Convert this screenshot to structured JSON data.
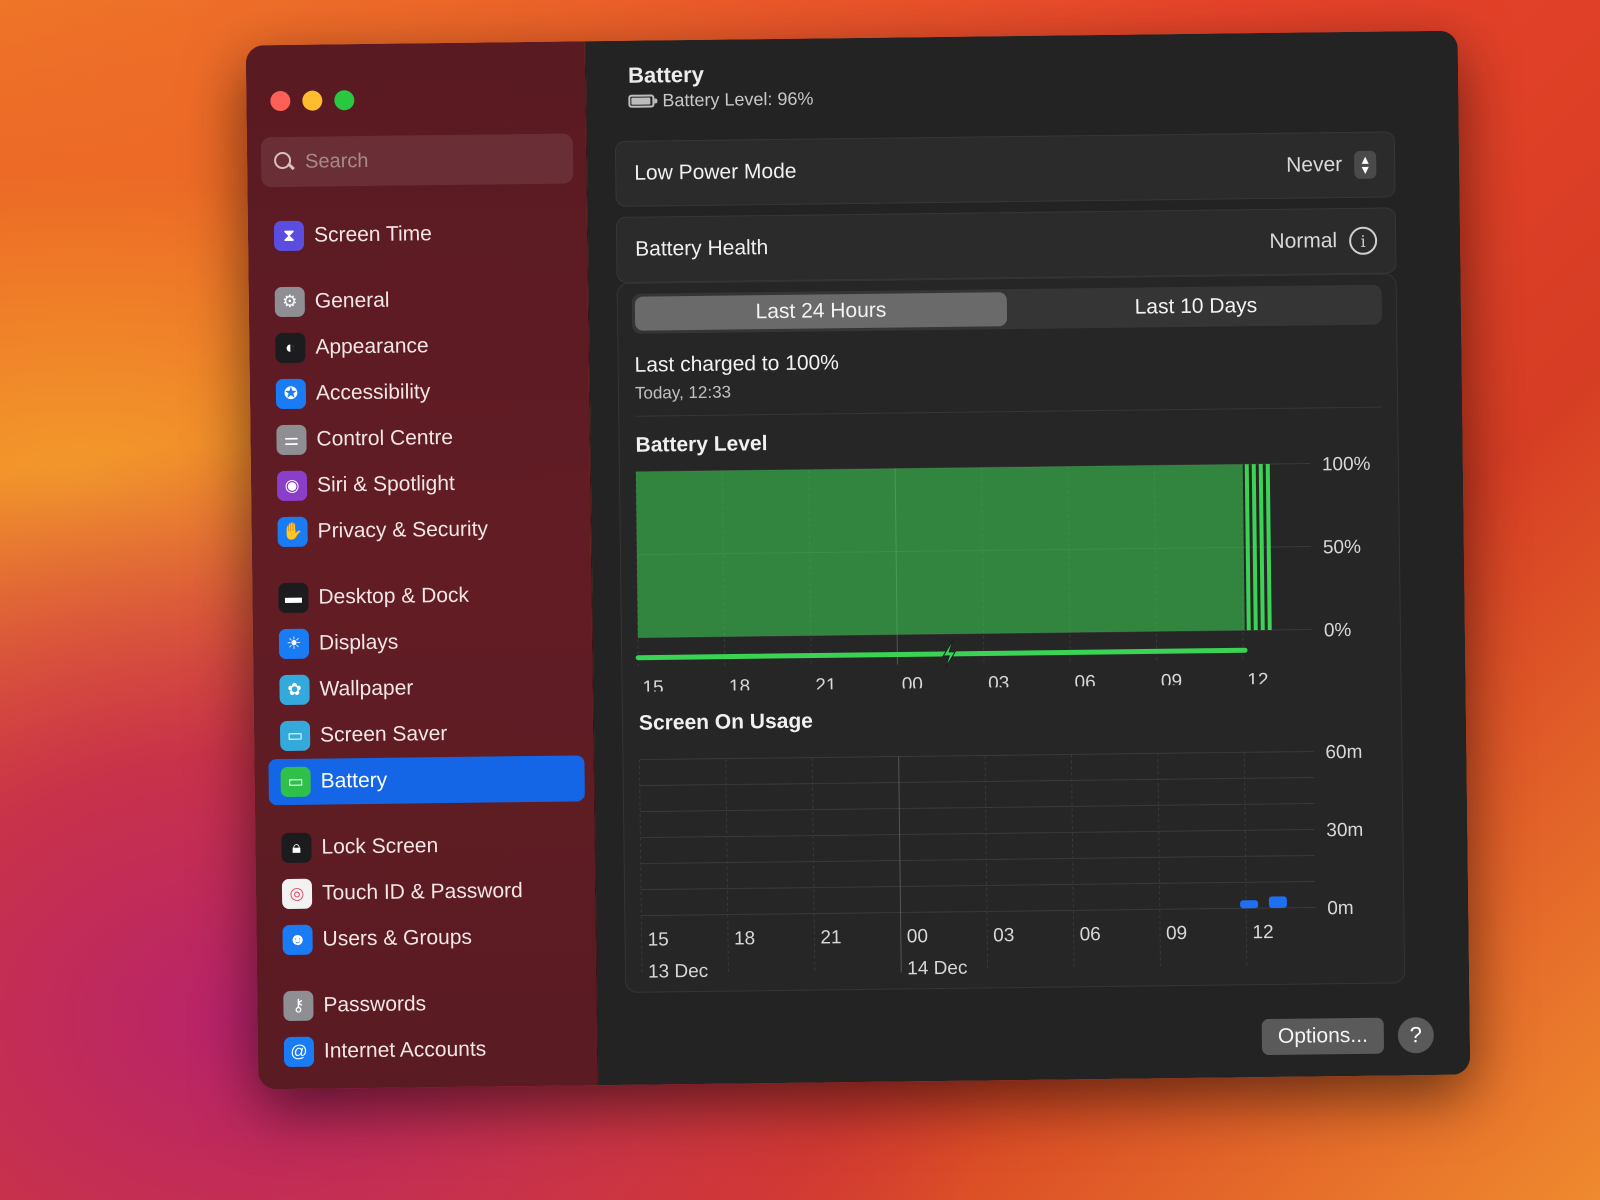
{
  "window": {
    "controls": [
      "close",
      "minimize",
      "zoom"
    ]
  },
  "sidebar": {
    "search_placeholder": "Search",
    "groups": [
      [
        {
          "label": "Screen Time",
          "icon": "hourglass-icon",
          "color": "#5b4de0"
        }
      ],
      [
        {
          "label": "General",
          "icon": "gear-icon",
          "color": "#8e8e93"
        },
        {
          "label": "Appearance",
          "icon": "appearance-icon",
          "color": "#1c1c1e"
        },
        {
          "label": "Accessibility",
          "icon": "accessibility-icon",
          "color": "#1a7cf5"
        },
        {
          "label": "Control Centre",
          "icon": "toggles-icon",
          "color": "#8e8e93"
        },
        {
          "label": "Siri & Spotlight",
          "icon": "siri-icon",
          "color": "#8a3ec9"
        },
        {
          "label": "Privacy & Security",
          "icon": "hand-icon",
          "color": "#1a7cf5"
        }
      ],
      [
        {
          "label": "Desktop & Dock",
          "icon": "dock-icon",
          "color": "#1c1c1e"
        },
        {
          "label": "Displays",
          "icon": "sun-icon",
          "color": "#1a7cf5"
        },
        {
          "label": "Wallpaper",
          "icon": "flower-icon",
          "color": "#34aadc"
        },
        {
          "label": "Screen Saver",
          "icon": "screensaver-icon",
          "color": "#34aadc"
        },
        {
          "label": "Battery",
          "icon": "battery-icon",
          "color": "#2fc04b",
          "selected": true
        }
      ],
      [
        {
          "label": "Lock Screen",
          "icon": "lock-icon",
          "color": "#1c1c1e"
        },
        {
          "label": "Touch ID & Password",
          "icon": "fingerprint-icon",
          "color": "#f2f2f2"
        },
        {
          "label": "Users & Groups",
          "icon": "users-icon",
          "color": "#1a7cf5"
        }
      ],
      [
        {
          "label": "Passwords",
          "icon": "key-icon",
          "color": "#8e8e93"
        },
        {
          "label": "Internet Accounts",
          "icon": "at-icon",
          "color": "#1a7cf5"
        }
      ]
    ]
  },
  "header": {
    "title": "Battery",
    "subtitle": "Battery Level: 96%"
  },
  "low_power": {
    "label": "Low Power Mode",
    "value": "Never"
  },
  "health": {
    "label": "Battery Health",
    "value": "Normal"
  },
  "tabs": [
    {
      "label": "Last 24 Hours",
      "active": true
    },
    {
      "label": "Last 10 Days",
      "active": false
    }
  ],
  "charged": {
    "title": "Last charged to 100%",
    "time": "Today, 12:33"
  },
  "footer": {
    "options_label": "Options...",
    "help_label": "?"
  },
  "chart_data": [
    {
      "type": "area",
      "title": "Battery Level",
      "x_ticks": [
        "15",
        "18",
        "21",
        "00",
        "03",
        "06",
        "09",
        "12"
      ],
      "y_ticks": [
        "100%",
        "50%",
        "0%"
      ],
      "ylim": [
        0,
        100
      ],
      "series": [
        {
          "values": [
            100,
            100,
            100,
            100,
            100,
            100,
            100,
            100
          ]
        }
      ],
      "charging_marker_at": "00",
      "color": "#3ad354"
    },
    {
      "type": "bar",
      "title": "Screen On Usage",
      "x_ticks": [
        "15",
        "18",
        "21",
        "00",
        "03",
        "06",
        "09",
        "12"
      ],
      "date_labels": [
        {
          "label": "13 Dec",
          "at": "15"
        },
        {
          "label": "14 Dec",
          "at": "00"
        }
      ],
      "y_ticks": [
        "60m",
        "30m",
        "0m"
      ],
      "ylim": [
        0,
        60
      ],
      "bars": [
        {
          "hour": "12",
          "minutes": 2
        },
        {
          "hour": "12.5",
          "minutes": 4
        }
      ],
      "color": "#1f6ff2"
    }
  ]
}
